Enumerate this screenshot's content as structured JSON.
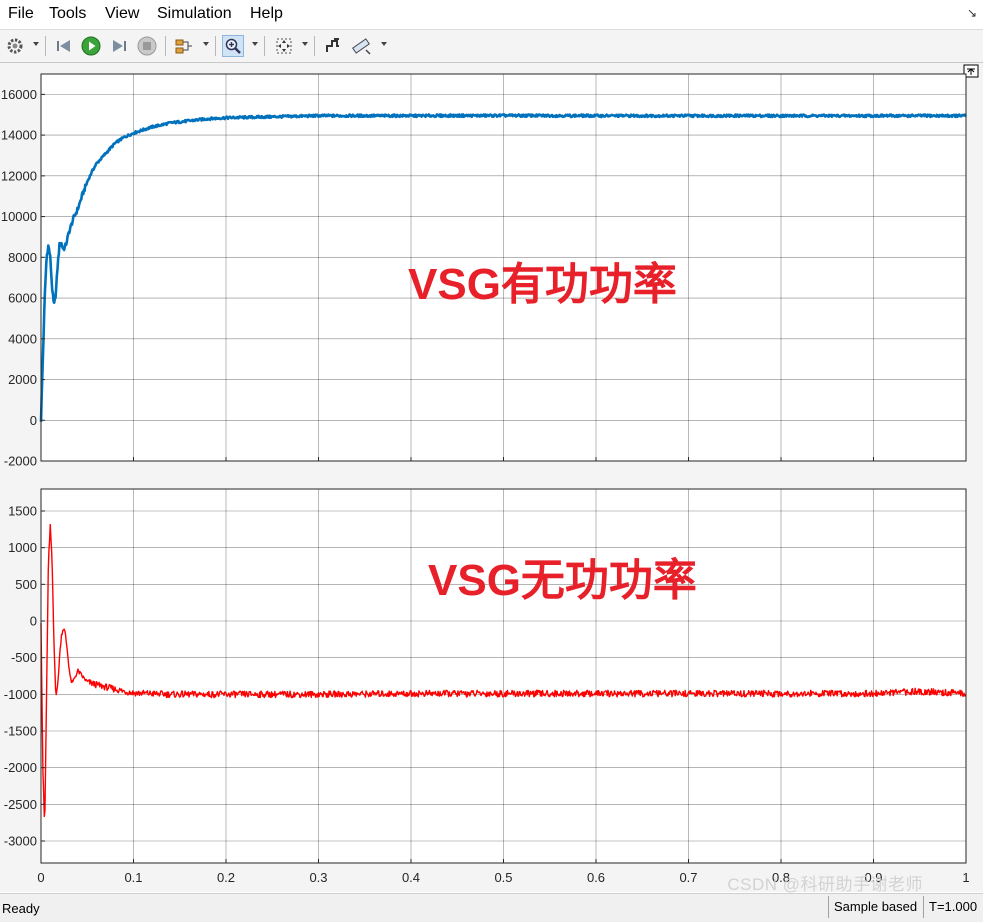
{
  "menu": {
    "items": [
      "File",
      "Tools",
      "View",
      "Simulation",
      "Help"
    ],
    "corner_icon": "undock-arrow-icon"
  },
  "toolbar": {
    "buttons": [
      {
        "name": "settings-gear-icon",
        "has_dropdown": true
      },
      {
        "name": "step-back-icon",
        "has_dropdown": false
      },
      {
        "name": "run-icon",
        "has_dropdown": false
      },
      {
        "name": "step-forward-icon",
        "has_dropdown": false
      },
      {
        "name": "stop-icon",
        "has_dropdown": false
      },
      {
        "name": "signal-selector-icon",
        "has_dropdown": true
      },
      {
        "name": "zoom-in-icon",
        "has_dropdown": true,
        "pressed": true
      },
      {
        "name": "fit-to-view-icon",
        "has_dropdown": true
      },
      {
        "name": "style-icon",
        "has_dropdown": false
      },
      {
        "name": "cursor-measure-icon",
        "has_dropdown": true
      }
    ]
  },
  "status": {
    "left": "Ready",
    "mode": "Sample based",
    "time": "T=1.000"
  },
  "watermark": "CSDN @科研助手谢老师",
  "chart_data": [
    {
      "type": "line",
      "title": "",
      "annotation": "VSG有功功率",
      "annotation_color": "#e8202a",
      "series": [
        {
          "color": "#0072bd",
          "x": [
            0,
            0.002,
            0.004,
            0.006,
            0.008,
            0.01,
            0.012,
            0.014,
            0.016,
            0.018,
            0.02,
            0.022,
            0.024,
            0.026,
            0.028,
            0.03,
            0.035,
            0.04,
            0.045,
            0.05,
            0.055,
            0.06,
            0.07,
            0.08,
            0.09,
            0.1,
            0.12,
            0.14,
            0.16,
            0.18,
            0.2,
            0.25,
            0.3,
            0.35,
            0.4,
            0.5,
            0.6,
            0.7,
            0.8,
            0.9,
            0.95,
            1.0
          ],
          "y": [
            0,
            3000,
            6000,
            8000,
            8600,
            8000,
            6500,
            5600,
            6200,
            7600,
            8600,
            8700,
            8400,
            8500,
            8800,
            9200,
            9900,
            10400,
            11100,
            11700,
            12200,
            12600,
            13100,
            13600,
            13900,
            14100,
            14400,
            14600,
            14700,
            14800,
            14850,
            14900,
            14950,
            14950,
            14950,
            14960,
            14950,
            14950,
            14950,
            14950,
            14950,
            14950
          ]
        }
      ],
      "xlim": [
        0,
        1
      ],
      "ylim": [
        -2000,
        17000
      ],
      "yticks": [
        -2000,
        0,
        2000,
        4000,
        6000,
        8000,
        10000,
        12000,
        14000,
        16000
      ],
      "xticks": [
        0,
        0.1,
        0.2,
        0.3,
        0.4,
        0.5,
        0.6,
        0.7,
        0.8,
        0.9,
        1
      ],
      "grid": true
    },
    {
      "type": "line",
      "title": "",
      "annotation": "VSG无功功率",
      "annotation_color": "#e8202a",
      "series": [
        {
          "color": "#ff0000",
          "x": [
            0,
            0.002,
            0.004,
            0.006,
            0.008,
            0.01,
            0.012,
            0.014,
            0.016,
            0.018,
            0.02,
            0.022,
            0.024,
            0.026,
            0.028,
            0.03,
            0.032,
            0.034,
            0.036,
            0.04,
            0.045,
            0.05,
            0.06,
            0.07,
            0.08,
            0.09,
            0.1,
            0.12,
            0.14,
            0.16,
            0.2,
            0.3,
            0.4,
            0.5,
            0.6,
            0.7,
            0.8,
            0.9,
            0.95,
            1.0
          ],
          "y": [
            0,
            -2000,
            -2850,
            -1000,
            800,
            1300,
            800,
            -300,
            -1000,
            -900,
            -500,
            -200,
            -100,
            -150,
            -350,
            -600,
            -800,
            -850,
            -780,
            -680,
            -760,
            -830,
            -870,
            -900,
            -930,
            -960,
            -980,
            -990,
            -1000,
            -1000,
            -1000,
            -1000,
            -990,
            -990,
            -990,
            -990,
            -990,
            -990,
            -960,
            -990
          ]
        }
      ],
      "xlim": [
        0,
        1
      ],
      "ylim": [
        -3300,
        1800
      ],
      "yticks": [
        -3000,
        -2500,
        -2000,
        -1500,
        -1000,
        -500,
        0,
        500,
        1000,
        1500
      ],
      "xticks": [
        0,
        0.1,
        0.2,
        0.3,
        0.4,
        0.5,
        0.6,
        0.7,
        0.8,
        0.9,
        1
      ],
      "grid": true
    }
  ]
}
